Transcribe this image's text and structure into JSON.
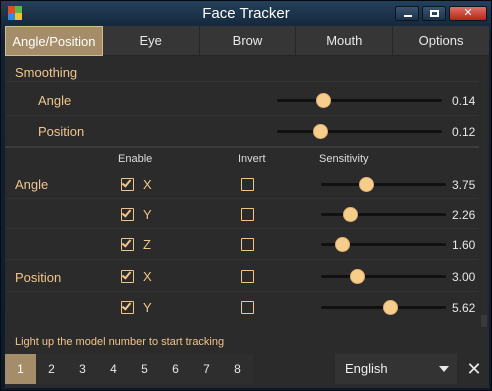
{
  "window": {
    "title": "Face Tracker",
    "minimize_icon": "minimize-icon",
    "maximize_icon": "maximize-icon",
    "close_icon": "close-icon"
  },
  "tabs": [
    {
      "label": "Angle/Position",
      "active": true
    },
    {
      "label": "Eye",
      "active": false
    },
    {
      "label": "Brow",
      "active": false
    },
    {
      "label": "Mouth",
      "active": false
    },
    {
      "label": "Options",
      "active": false
    }
  ],
  "smoothing": {
    "header": "Smoothing",
    "angle": {
      "label": "Angle",
      "value": "0.14",
      "level": 0.28
    },
    "position": {
      "label": "Position",
      "value": "0.12",
      "level": 0.26
    }
  },
  "columns": {
    "enable": "Enable",
    "invert": "Invert",
    "sensitivity": "Sensitivity"
  },
  "angle": {
    "label": "Angle",
    "axes": [
      {
        "axis": "X",
        "enabled": true,
        "inverted": false,
        "value": "3.75",
        "level": 0.36
      },
      {
        "axis": "Y",
        "enabled": true,
        "inverted": false,
        "value": "2.26",
        "level": 0.23
      },
      {
        "axis": "Z",
        "enabled": true,
        "inverted": false,
        "value": "1.60",
        "level": 0.17
      }
    ]
  },
  "position": {
    "label": "Position",
    "axes": [
      {
        "axis": "X",
        "enabled": true,
        "inverted": false,
        "value": "3.00",
        "level": 0.29
      },
      {
        "axis": "Y",
        "enabled": true,
        "inverted": false,
        "value": "5.62",
        "level": 0.55
      }
    ]
  },
  "footer": {
    "status": "Light up the model number to start tracking",
    "models": [
      "1",
      "2",
      "3",
      "4",
      "5",
      "6",
      "7",
      "8"
    ],
    "active_model": "1",
    "language": "English",
    "close_label": "✕"
  },
  "colors": {
    "accent": "#a48d68",
    "label": "#f1c58a",
    "thumb": "#f7cd8b"
  }
}
